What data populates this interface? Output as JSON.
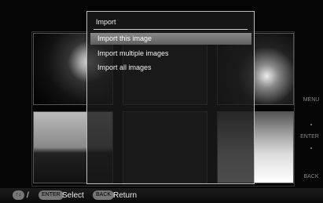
{
  "dialog": {
    "title": "Import",
    "items": [
      {
        "label": "Import this image",
        "selected": true
      },
      {
        "label": "Import multiple images",
        "selected": false
      },
      {
        "label": "Import all images",
        "selected": false
      }
    ]
  },
  "right_panel": {
    "menu": "MENU",
    "enter": "ENTER",
    "back": "BACK"
  },
  "bottom_bar": {
    "nav_icon": "up-down-arrows-icon",
    "nav_glyph": "↑↓",
    "separator": "/",
    "enter_key": "ENTER",
    "select_label": "Select",
    "back_key": "BACK",
    "return_label": "Return"
  },
  "colors": {
    "selection": "#6f6f6f",
    "dialog_border": "#bdbdbd",
    "background": "#000000"
  }
}
